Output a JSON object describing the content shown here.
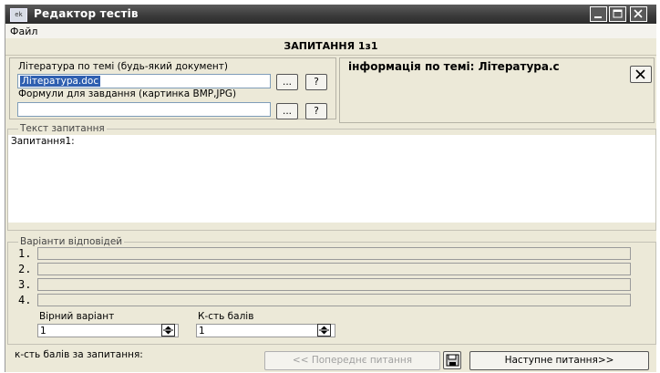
{
  "window": {
    "title": "Редактор тестів",
    "app_icon": "ek"
  },
  "menu": {
    "file": "Файл"
  },
  "question_title": "ЗАПИТАННЯ 1з1",
  "literature": {
    "label": "Література по темі (будь-який документ)",
    "value": "Література.doc",
    "browse_label": "...",
    "help_label": "?"
  },
  "formulas": {
    "label": "Формули для завдання (картинка BMP,JPG)",
    "value": "",
    "browse_label": "...",
    "help_label": "?"
  },
  "info": {
    "text": "інформація по темі: Література.с",
    "close_icon": "x-icon"
  },
  "question_text": {
    "group_label": "Текст запитання",
    "value": "Запитання1:"
  },
  "answers": {
    "group_label": "Варіанти відповідей",
    "items": [
      {
        "num": "1.",
        "value": ""
      },
      {
        "num": "2.",
        "value": ""
      },
      {
        "num": "3.",
        "value": ""
      },
      {
        "num": "4.",
        "value": ""
      }
    ]
  },
  "correct": {
    "label": "Вірний варіант",
    "value": "1"
  },
  "points": {
    "label": "К-сть балів",
    "value": "1"
  },
  "footer": {
    "total_label": "к-сть балів за запитання:",
    "prev_label": "<< Попереднє питання",
    "save_icon": "floppy-disk-icon",
    "next_label": "Наступне питання>>"
  }
}
